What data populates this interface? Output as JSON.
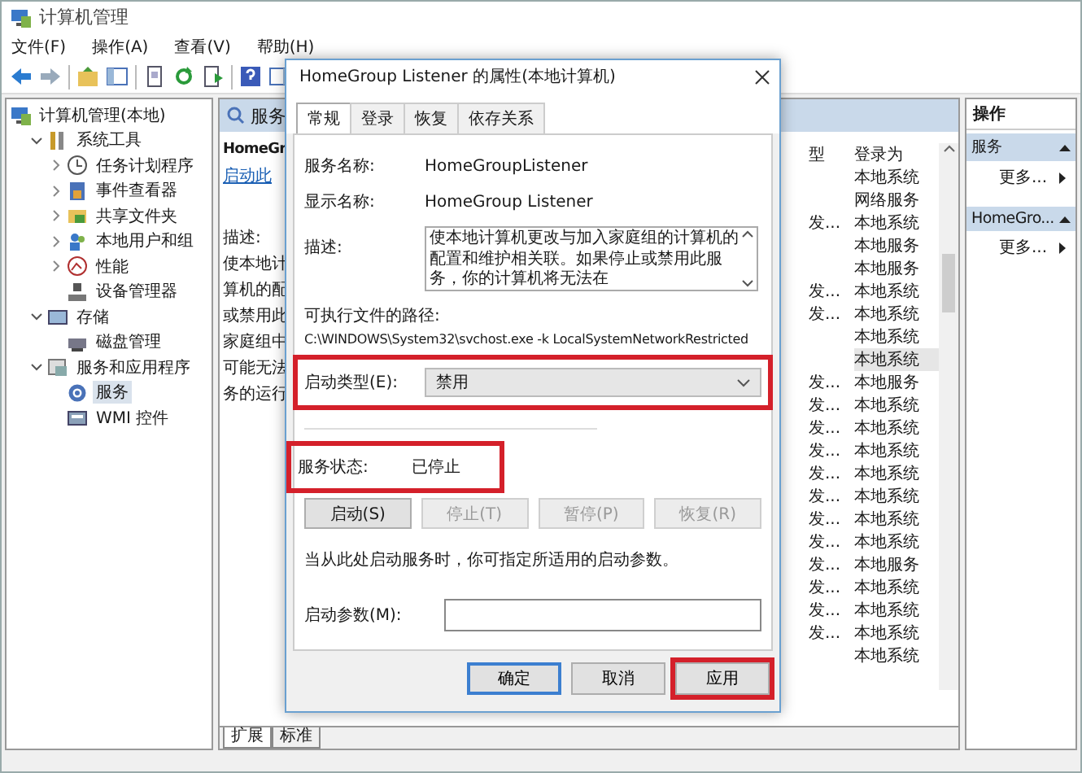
{
  "window": {
    "title": "计算机管理"
  },
  "menu": [
    "文件(F)",
    "操作(A)",
    "查看(V)",
    "帮助(H)"
  ],
  "tree": [
    {
      "label": "计算机管理(本地)",
      "selected": false,
      "children": [
        {
          "label": "系统工具",
          "expanded": true,
          "selected": false,
          "children": [
            {
              "label": "任务计划程序",
              "expanded": false,
              "selected": false
            },
            {
              "label": "事件查看器",
              "expanded": false,
              "selected": false
            },
            {
              "label": "共享文件夹",
              "expanded": false,
              "selected": false
            },
            {
              "label": "本地用户和组",
              "expanded": false,
              "selected": false
            },
            {
              "label": "性能",
              "expanded": false,
              "selected": false
            },
            {
              "label": "设备管理器",
              "selected": false
            }
          ]
        },
        {
          "label": "存储",
          "expanded": true,
          "selected": false,
          "children": [
            {
              "label": "磁盘管理",
              "selected": false
            }
          ]
        },
        {
          "label": "服务和应用程序",
          "expanded": true,
          "selected": false,
          "children": [
            {
              "label": "服务",
              "selected": true
            },
            {
              "label": "WMI 控件",
              "selected": false
            }
          ]
        }
      ]
    }
  ],
  "services_panel": {
    "title": "服务",
    "detail": {
      "name": "HomeGr",
      "link": "启动此",
      "description_label": "描述:",
      "description_lines": [
        "使本地计",
        "算机的配",
        "或禁用此",
        "家庭组中",
        "可能无法",
        "务的运行"
      ]
    },
    "columns": [
      "型",
      "登录为"
    ],
    "rows": [
      {
        "logon": "本地系统",
        "selected": false
      },
      {
        "logon": "网络服务",
        "selected": false
      },
      {
        "startup": "发...",
        "logon": "本地系统",
        "selected": false
      },
      {
        "logon": "本地服务",
        "selected": false
      },
      {
        "logon": "本地服务",
        "selected": false
      },
      {
        "startup": "发...",
        "logon": "本地系统",
        "selected": false
      },
      {
        "startup": "发...",
        "logon": "本地系统",
        "selected": false
      },
      {
        "logon": "本地系统",
        "selected": false
      },
      {
        "logon": "本地系统",
        "selected": true
      },
      {
        "startup": "发...",
        "logon": "本地服务",
        "selected": false
      },
      {
        "startup": "发...",
        "logon": "本地系统",
        "selected": false
      },
      {
        "startup": "发...",
        "logon": "本地系统",
        "selected": false
      },
      {
        "startup": "发...",
        "logon": "本地系统",
        "selected": false
      },
      {
        "startup": "发...",
        "logon": "本地系统",
        "selected": false
      },
      {
        "startup": "发...",
        "logon": "本地系统",
        "selected": false
      },
      {
        "startup": "发...",
        "logon": "本地系统",
        "selected": false
      },
      {
        "startup": "发...",
        "logon": "本地系统",
        "selected": false
      },
      {
        "startup": "发...",
        "logon": "本地服务",
        "selected": false
      },
      {
        "startup": "发...",
        "logon": "本地系统",
        "selected": false
      },
      {
        "startup": "发...",
        "logon": "本地系统",
        "selected": false
      },
      {
        "startup": "发...",
        "logon": "本地系统",
        "selected": false
      },
      {
        "logon": "本地系统",
        "selected": false
      }
    ],
    "view_tabs": [
      {
        "label": "扩展",
        "selected": true
      },
      {
        "label": "标准",
        "selected": false
      }
    ]
  },
  "actions_panel": {
    "title": "操作",
    "sections": [
      {
        "title": "服务",
        "expanded": true,
        "items": [
          "更多..."
        ]
      },
      {
        "title": "HomeGro...",
        "expanded": true,
        "items": [
          "更多..."
        ]
      }
    ]
  },
  "dialog": {
    "title": "HomeGroup Listener 的属性(本地计算机)",
    "tabs": [
      {
        "label": "常规",
        "selected": true
      },
      {
        "label": "登录",
        "selected": false
      },
      {
        "label": "恢复",
        "selected": false
      },
      {
        "label": "依存关系",
        "selected": false
      }
    ],
    "fields": [
      {
        "label": "服务名称:",
        "value": "HomeGroupListener"
      },
      {
        "label": "显示名称:",
        "value": "HomeGroup Listener"
      }
    ],
    "description": {
      "label": "描述:",
      "text": "使本地计算机更改与加入家庭组的计算机的配置和维护相关联。如果停止或禁用此服务，你的计算机将无法在"
    },
    "path": {
      "label": "可执行文件的路径:",
      "value": "C:\\WINDOWS\\System32\\svchost.exe -k LocalSystemNetworkRestricted"
    },
    "startup_type": {
      "label": "启动类型(E):",
      "value": "禁用",
      "highlighted": true
    },
    "service_status": {
      "label": "服务状态:",
      "value": "已停止",
      "highlighted": true
    },
    "control_buttons": [
      {
        "label": "启动(S)",
        "disabled": false
      },
      {
        "label": "停止(T)",
        "disabled": true
      },
      {
        "label": "暂停(P)",
        "disabled": true
      },
      {
        "label": "恢复(R)",
        "disabled": true
      }
    ],
    "hint": "当从此处启动服务时，你可指定所适用的启动参数。",
    "start_params": {
      "label": "启动参数(M):"
    },
    "buttons": [
      {
        "label": "确定",
        "default": true,
        "highlighted": false
      },
      {
        "label": "取消",
        "default": false,
        "highlighted": false
      },
      {
        "label": "应用",
        "default": false,
        "highlighted": true
      }
    ]
  }
}
